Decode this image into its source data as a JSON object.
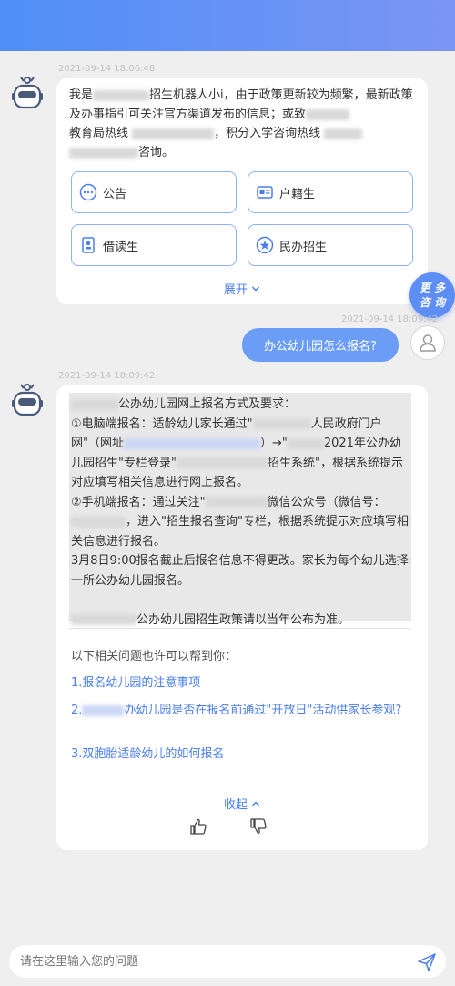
{
  "header": {
    "color_start": "#4f8ff8",
    "color_end": "#7b95f4"
  },
  "messages": {
    "intro": {
      "timestamp": "2021-09-14 18:06:48",
      "text_1": "我是",
      "text_2": "招生机器人小i，由于政策更新较为频繁，最新政策及办事指引可关注官方渠道发布的信息；或致",
      "text_3": "教育局热线",
      "text_4": "，积分入学咨询热线",
      "text_5": "咨询。",
      "buttons": [
        {
          "label": "公告",
          "icon": "dots-circle-icon"
        },
        {
          "label": "户籍生",
          "icon": "id-card-icon"
        },
        {
          "label": "借读生",
          "icon": "badge-icon"
        },
        {
          "label": "民办招生",
          "icon": "star-circle-icon"
        }
      ],
      "expand_label": "展开"
    },
    "more_button": {
      "line1": "更 多",
      "line2": "咨 询"
    },
    "user": {
      "timestamp": "2021-09-14 18:09:42",
      "text": "办公幼儿园怎么报名?"
    },
    "answer": {
      "timestamp": "2021-09-14 18:09:42",
      "p1": "公办幼儿园网上报名方式及要求：",
      "p2a": "①电脑端报名：适龄幼儿家长通过\"",
      "p2b": "人民政府门户网\"（网址",
      "p2c": "）→\"",
      "p2d": "2021年公办幼儿园招生\"专栏登录\"",
      "p2e": "招生系统\"，根据系统提示对应填写相关信息进行网上报名。",
      "p3a": "②手机端报名：通过关注\"",
      "p3b": "微信公众号（微信号：",
      "p3c": "，进入\"招生报名查询\"专栏，根据系统提示对应填写相关信息进行报名。",
      "p4": "3月8日9:00报名截止后报名信息不得更改。家长为每个幼儿选择一所公办幼儿园报名。",
      "p5": "公办幼儿园招生政策请以当年公布为准。",
      "related_title": "以下相关问题也许可以帮到你：",
      "related": [
        "1.报名幼儿园的注意事项",
        "2.",
        "办幼儿园是否在报名前通过\"开放日\"活动供家长参观?",
        "3.双胞胎适龄幼儿的如何报名"
      ],
      "collapse_label": "收起"
    }
  },
  "input": {
    "placeholder": "请在这里输入您的问题"
  },
  "accent": "#4a7ef0"
}
